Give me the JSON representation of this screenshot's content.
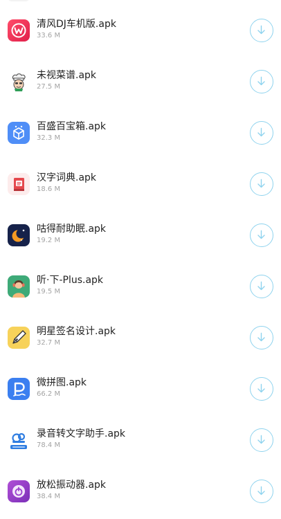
{
  "items": [
    {
      "name": "清风DJ车机版.apk",
      "size": "33.6 M",
      "icon": "qingfeng-dj-icon"
    },
    {
      "name": "未视菜谱.apk",
      "size": "27.5 M",
      "icon": "chef-icon"
    },
    {
      "name": "百盛百宝箱.apk",
      "size": "32.3 M",
      "icon": "toolbox-icon"
    },
    {
      "name": "汉字词典.apk",
      "size": "18.6 M",
      "icon": "dictionary-icon"
    },
    {
      "name": "咕得耐助眠.apk",
      "size": "19.2 M",
      "icon": "moon-sleep-icon"
    },
    {
      "name": "听·下-Plus.apk",
      "size": "19.5 M",
      "icon": "listen-avatar-icon"
    },
    {
      "name": "明星签名设计.apk",
      "size": "32.7 M",
      "icon": "pen-nib-icon"
    },
    {
      "name": "微拼图.apk",
      "size": "66.2 M",
      "icon": "puzzle-p-icon"
    },
    {
      "name": "录音转文字助手.apk",
      "size": "78.4 M",
      "icon": "voice-to-text-icon"
    },
    {
      "name": "放松振动器.apk",
      "size": "38.4 M",
      "icon": "vibrator-icon"
    }
  ],
  "colors": {
    "accent": "#8fd3ee",
    "title": "#222222",
    "subtitle": "#a3a3a3"
  }
}
